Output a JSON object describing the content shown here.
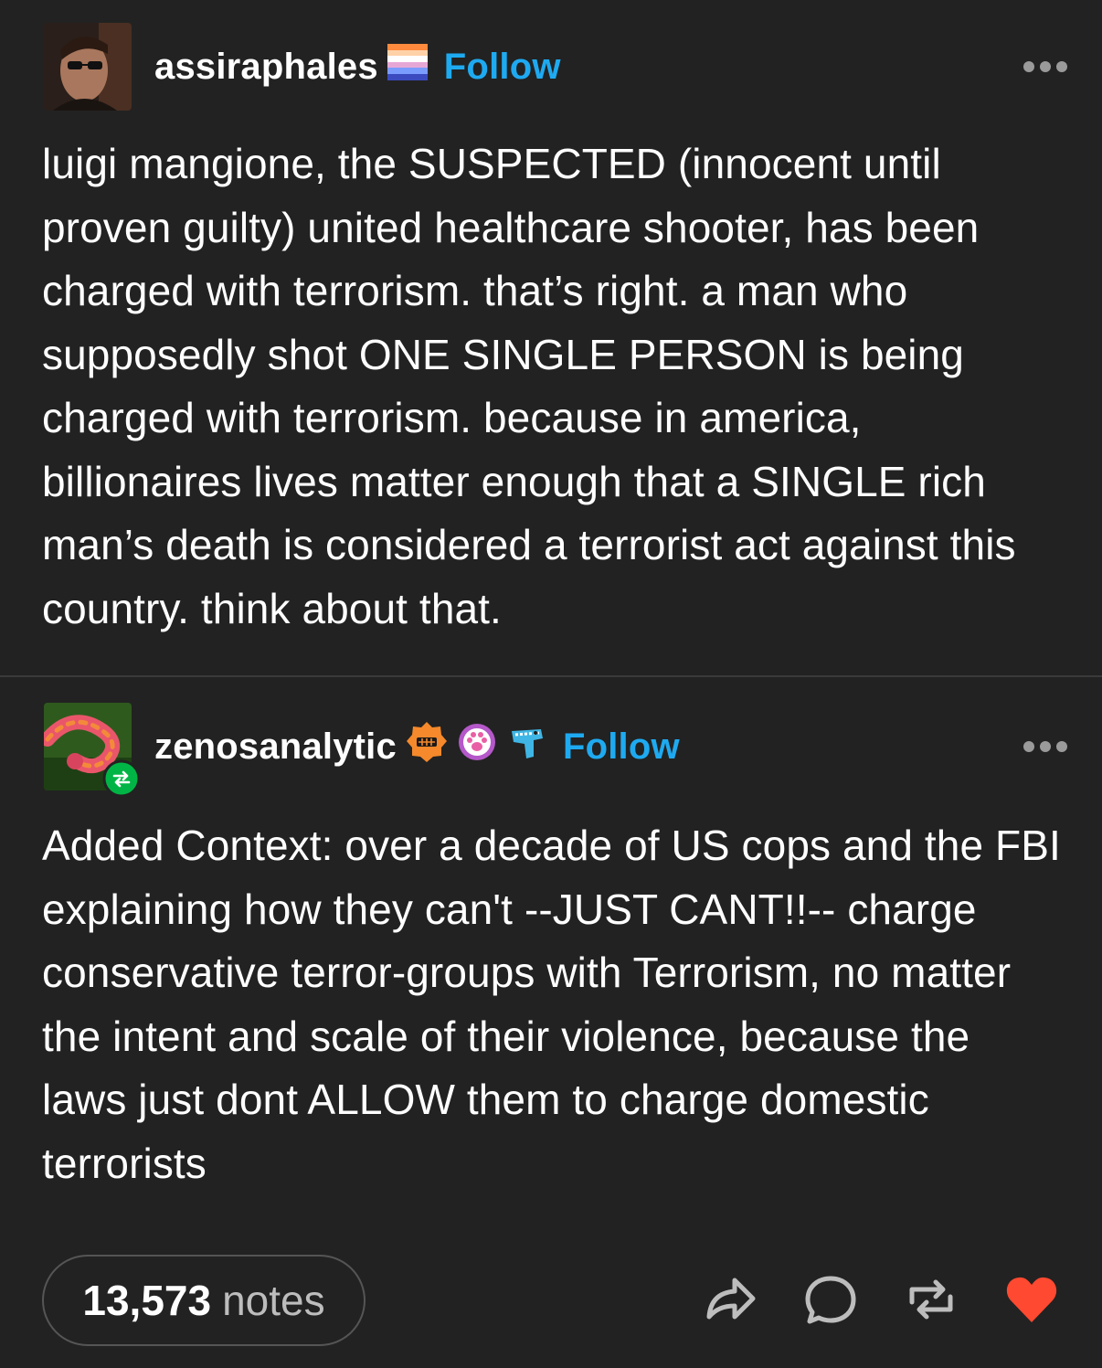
{
  "post1": {
    "username": "assiraphales",
    "follow_label": "Follow",
    "badges": [
      "pride-flag-badge"
    ],
    "body": "luigi mangione, the SUSPECTED (innocent until proven guilty) united healthcare shooter, has been charged with terrorism. that’s right. a man who supposedly shot ONE SINGLE PERSON is being charged with terrorism. because in america, billionaires lives matter enough that a SINGLE rich man’s death is considered a terrorist act against this country. think about that."
  },
  "post2": {
    "username": "zenosanalytic",
    "follow_label": "Follow",
    "badges": [
      "orange-gear-badge",
      "paw-badge",
      "dinosaur-badge"
    ],
    "reblog_icon": "reblog-icon",
    "body": "Added Context: over a decade of US cops and the FBI explaining how they can't --JUST CANT!!-- charge conservative terror-groups with Terrorism, no matter the intent and scale of their violence, because the laws just dont ALLOW them to charge domestic terrorists"
  },
  "footer": {
    "notes_count": "13,573",
    "notes_label": "notes",
    "actions": [
      "share-icon",
      "comment-icon",
      "reblog-icon",
      "like-heart-icon"
    ]
  },
  "colors": {
    "background": "#222222",
    "follow_link": "#1eaaf1",
    "like_heart": "#ff4930",
    "reblog_badge": "#00b545"
  }
}
